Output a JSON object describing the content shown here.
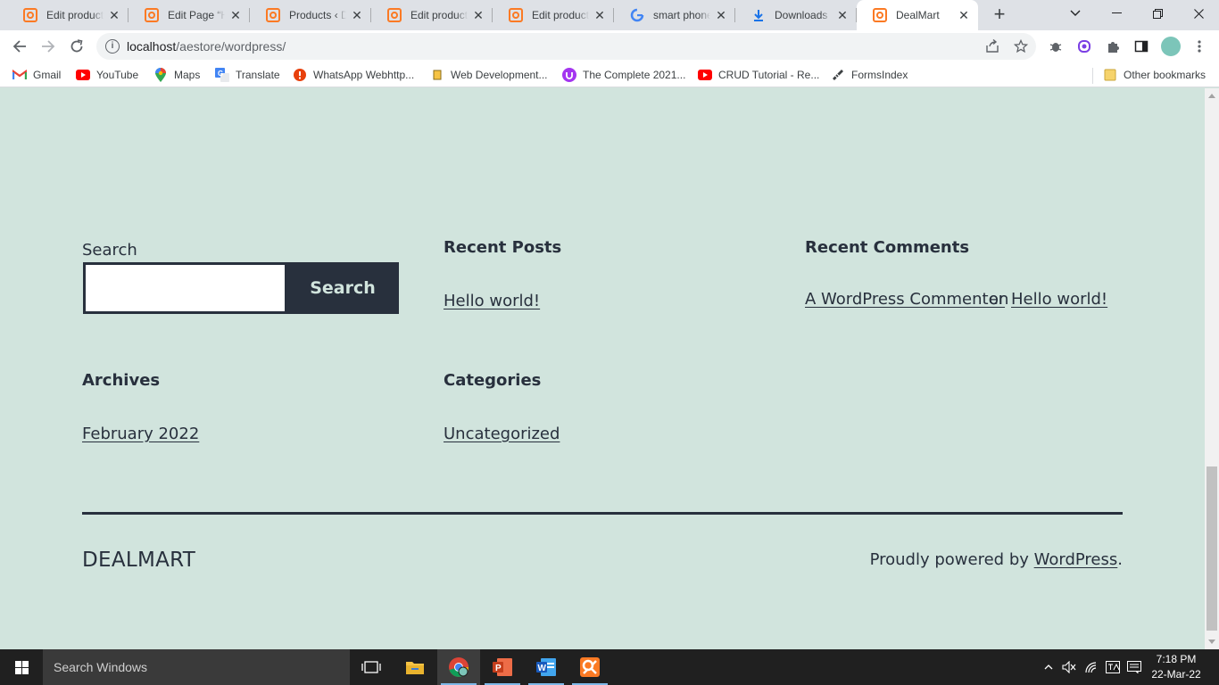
{
  "browser": {
    "tabs": [
      {
        "title": "Edit product “",
        "icon": "xampp-icon",
        "active": false
      },
      {
        "title": "Edit Page “Ho",
        "icon": "xampp-icon",
        "active": false
      },
      {
        "title": "Products ‹ De",
        "icon": "xampp-icon",
        "active": false
      },
      {
        "title": "Edit product “",
        "icon": "xampp-icon",
        "active": false
      },
      {
        "title": "Edit product “",
        "icon": "xampp-icon",
        "active": false
      },
      {
        "title": "smart phone",
        "icon": "google-icon",
        "active": false
      },
      {
        "title": "Downloads",
        "icon": "download-icon",
        "active": false
      },
      {
        "title": "DealMart",
        "icon": "xampp-icon",
        "active": true
      }
    ],
    "url_host": "localhost",
    "url_path": "/aestore/wordpress/",
    "bookmarks": [
      {
        "label": "Gmail",
        "icon": "gmail-icon"
      },
      {
        "label": "YouTube",
        "icon": "youtube-icon"
      },
      {
        "label": "Maps",
        "icon": "maps-icon"
      },
      {
        "label": "Translate",
        "icon": "translate-icon"
      },
      {
        "label": "WhatsApp Webhttp...",
        "icon": "alert-icon"
      },
      {
        "label": "Web Development...",
        "icon": "bookmark-icon"
      },
      {
        "label": "The Complete 2021...",
        "icon": "udemy-icon"
      },
      {
        "label": "CRUD Tutorial - Re...",
        "icon": "youtube-icon"
      },
      {
        "label": "FormsIndex",
        "icon": "forms-icon"
      }
    ],
    "other_bookmarks": "Other bookmarks"
  },
  "page": {
    "search_title": "Search",
    "search_button": "Search",
    "recent_posts_title": "Recent Posts",
    "recent_post_link": "Hello world!",
    "recent_comments_title": "Recent Comments",
    "comment_author": "A WordPress Commenter",
    "comment_on": "on",
    "comment_post": "Hello world!",
    "archives_title": "Archives",
    "archive_link": "February 2022",
    "categories_title": "Categories",
    "category_link": "Uncategorized",
    "site_title": "DEALMART",
    "powered_prefix": "Proudly powered by ",
    "powered_link": "WordPress",
    "powered_suffix": "."
  },
  "taskbar": {
    "search_placeholder": "Search Windows",
    "time": "7:18 PM",
    "date": "22-Mar-22"
  },
  "colors": {
    "page_bg": "#d1e4dd",
    "text": "#28303d",
    "xampp_orange": "#fb7a24"
  }
}
